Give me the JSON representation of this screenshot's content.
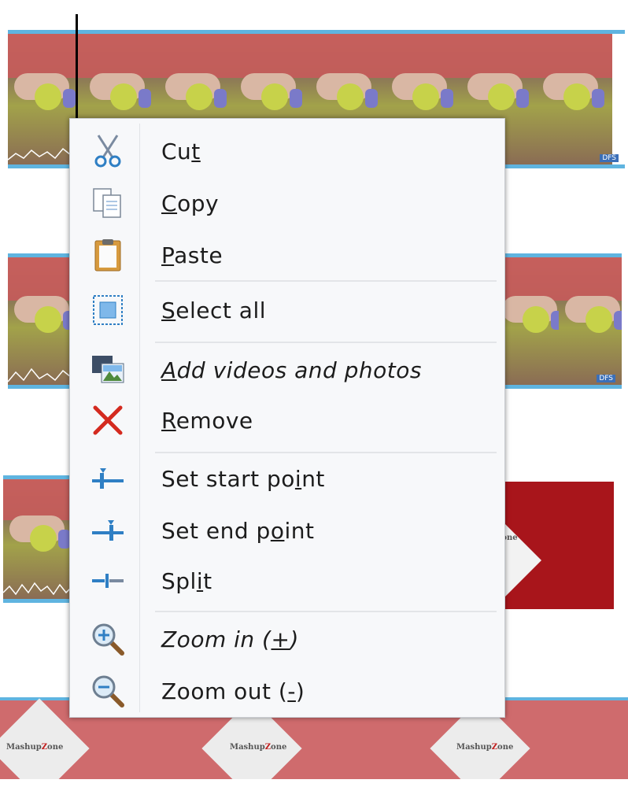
{
  "menu": {
    "items": [
      {
        "id": "cut",
        "label": "Cut",
        "icon": "scissors-icon",
        "pre": "Cu",
        "acc": "t",
        "post": ""
      },
      {
        "id": "copy",
        "label": "Copy",
        "icon": "copy-icon",
        "pre": "",
        "acc": "C",
        "post": "opy"
      },
      {
        "id": "paste",
        "label": "Paste",
        "icon": "paste-icon",
        "pre": "",
        "acc": "P",
        "post": "aste"
      },
      {
        "id": "select-all",
        "label": "Select all",
        "icon": "select-all-icon",
        "pre": "",
        "acc": "S",
        "post": "elect all"
      },
      {
        "id": "add-videos-photos",
        "label": "Add videos and photos",
        "icon": "add-media-icon",
        "pre": "",
        "acc": "A",
        "post": "dd videos and photos"
      },
      {
        "id": "remove",
        "label": "Remove",
        "icon": "remove-icon",
        "pre": "",
        "acc": "R",
        "post": "emove"
      },
      {
        "id": "set-start-point",
        "label": "Set start point",
        "icon": "set-start-point-icon",
        "pre": "Set start po",
        "acc": "i",
        "post": "nt"
      },
      {
        "id": "set-end-point",
        "label": "Set end point",
        "icon": "set-end-point-icon",
        "pre": "Set end p",
        "acc": "o",
        "post": "int"
      },
      {
        "id": "split",
        "label": "Split",
        "icon": "split-icon",
        "pre": "Spl",
        "acc": "i",
        "post": "t"
      },
      {
        "id": "zoom-in",
        "label": "Zoom in (+)",
        "icon": "zoom-in-icon",
        "pre": "Zoom in (",
        "acc": "+",
        "post": ")"
      },
      {
        "id": "zoom-out",
        "label": "Zoom out (-)",
        "icon": "zoom-out-icon",
        "pre": "Zoom out (",
        "acc": "-",
        "post": ")"
      }
    ]
  },
  "timeline": {
    "badge": "DFS",
    "logo_prefix": "Mashup",
    "logo_z": "Z",
    "logo_suffix": "one"
  },
  "colors": {
    "menu_bg": "#f7f8fa",
    "timeline_accent": "#5fb4e0",
    "remove_red": "#d42a1f",
    "icon_blue": "#2f7fc4"
  }
}
